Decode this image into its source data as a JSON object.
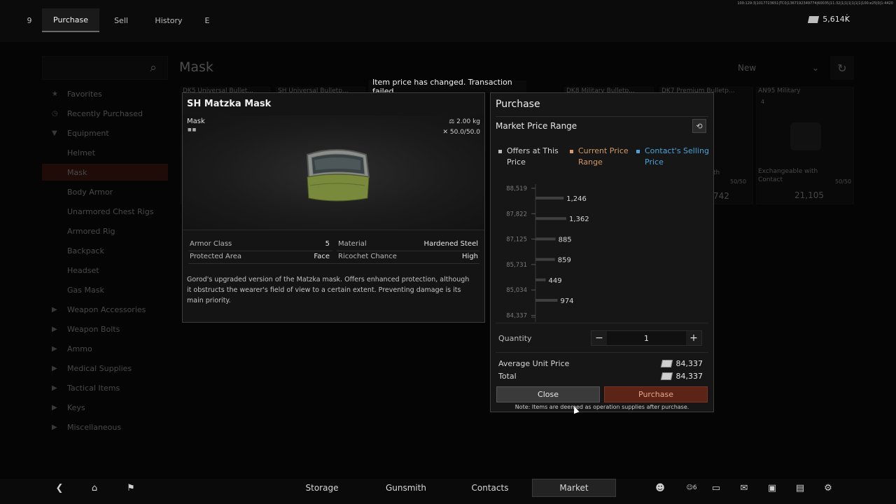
{
  "top_tabs": [
    "9",
    "Purchase",
    "Sell",
    "History",
    "E"
  ],
  "debug_line": "100:129:3|1017723651|TC0|1367192349774|60035|11:32|1|1|1|1|1|1|100:e25|0|1:4420",
  "currency": {
    "value": "5,614K",
    "icon": "currency-icon"
  },
  "search": {
    "placeholder": ""
  },
  "sidebar": {
    "items": [
      {
        "label": "Favorites",
        "icon": "star-icon"
      },
      {
        "label": "Recently Purchased",
        "icon": "clock-icon"
      },
      {
        "label": "Equipment",
        "icon": "triangle-down-icon"
      },
      {
        "label": "Helmet",
        "icon": ""
      },
      {
        "label": "Mask",
        "icon": ""
      },
      {
        "label": "Body Armor",
        "icon": ""
      },
      {
        "label": "Unarmored Chest Rigs",
        "icon": ""
      },
      {
        "label": "Armored Rig",
        "icon": ""
      },
      {
        "label": "Backpack",
        "icon": ""
      },
      {
        "label": "Headset",
        "icon": ""
      },
      {
        "label": "Gas Mask",
        "icon": ""
      },
      {
        "label": "Weapon Accessories",
        "icon": "triangle-right-icon"
      },
      {
        "label": "Weapon Bolts",
        "icon": "triangle-right-icon"
      },
      {
        "label": "Ammo",
        "icon": "triangle-right-icon"
      },
      {
        "label": "Medical Supplies",
        "icon": "triangle-right-icon"
      },
      {
        "label": "Tactical Items",
        "icon": "triangle-right-icon"
      },
      {
        "label": "Keys",
        "icon": "triangle-right-icon"
      },
      {
        "label": "Miscellaneous",
        "icon": "triangle-right-icon"
      }
    ]
  },
  "page_heading": "Mask",
  "sort": {
    "label": "New"
  },
  "cards": [
    {
      "title": "DK5 Universal Bullet..."
    },
    {
      "title": "SH Universal Bulletp..."
    },
    {
      "title": "DK8 Military Bulletp..."
    },
    {
      "title": "DK7 Premium Bulletp..."
    },
    {
      "title": "AN95 Military",
      "count": "4",
      "note": "Exchangeable with Contact",
      "durability": "50/50",
      "price": "21,105"
    }
  ],
  "card_partial": {
    "text1": "th",
    "durability": "50/50",
    "price": "742"
  },
  "toast": "Item price has changed. Transaction failed.",
  "item": {
    "name": "SH Matzka Mask",
    "type": "Mask",
    "dots": "■■",
    "weight": "2.00 kg",
    "durability": "50.0/50.0",
    "stats": [
      {
        "label": "Armor Class",
        "value": "5"
      },
      {
        "label": "Material",
        "value": "Hardened Steel"
      },
      {
        "label": "Protected Area",
        "value": "Face"
      },
      {
        "label": "Ricochet Chance",
        "value": "High"
      }
    ],
    "description": "Gorod's upgraded version of the Matzka mask. Offers enhanced protection, although it obstructs the wearer's field of view to a certain extent. Preventing damage is its main priority."
  },
  "purchase": {
    "title": "Purchase",
    "market_label": "Market Price Range",
    "legend": [
      {
        "label": "Offers at This Price",
        "color": "#bdbdbd"
      },
      {
        "label": "Current Price Range",
        "color": "#d19a66"
      },
      {
        "label": "Contact's Selling Price",
        "color": "#4aa3d8"
      }
    ],
    "quantity_label": "Quantity",
    "quantity": "1",
    "avg_label": "Average Unit Price",
    "avg_value": "84,337",
    "total_label": "Total",
    "total_value": "84,337",
    "close_label": "Close",
    "purchase_label": "Purchase",
    "note": "Note: Items are deemed as operation supplies after purchase."
  },
  "chart_data": {
    "type": "bar",
    "orientation": "horizontal",
    "y_tick_labels": [
      "88,519",
      "87,822",
      "87,125",
      "85,731",
      "85,034",
      "84,337"
    ],
    "bars": [
      {
        "value": 1246,
        "label": "1,246"
      },
      {
        "value": 1362,
        "label": "1,362"
      },
      {
        "value": 885,
        "label": "885"
      },
      {
        "value": 859,
        "label": "859"
      },
      {
        "value": 449,
        "label": "449"
      },
      {
        "value": 974,
        "label": "974"
      }
    ],
    "bar_color": "#3f3f3f"
  },
  "bottom_nav": [
    "Storage",
    "Gunsmith",
    "Contacts",
    "Market"
  ],
  "bottom_right_icons": [
    "friends-icon",
    "party-icon",
    "chat-icon",
    "mail-icon",
    "briefcase-icon",
    "document-icon",
    "settings-icon"
  ],
  "bottom_right_party_count": "6",
  "bottom_left_icons": [
    "back-icon",
    "home-icon",
    "flag-icon"
  ]
}
